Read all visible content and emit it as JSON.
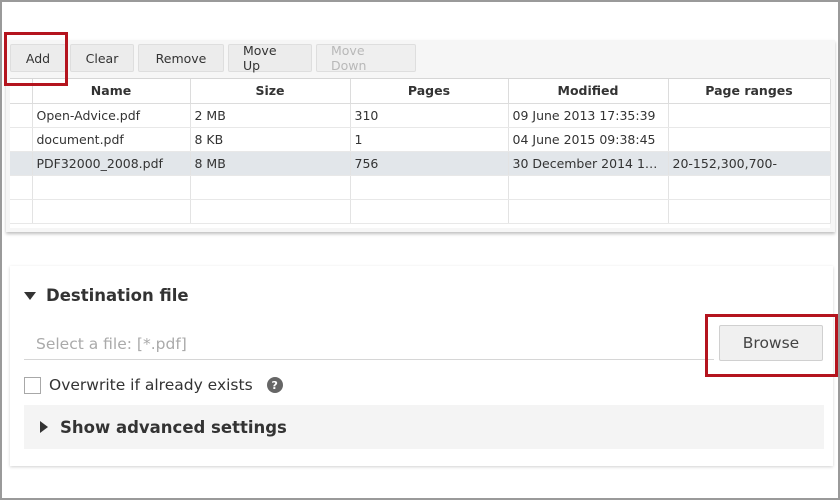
{
  "toolbar": {
    "add_label": "Add",
    "clear_label": "Clear",
    "remove_label": "Remove",
    "move_up_label": "Move Up",
    "move_down_label": "Move Down"
  },
  "table": {
    "columns": [
      "Name",
      "Size",
      "Pages",
      "Modified",
      "Page ranges"
    ],
    "rows": [
      {
        "name": "Open-Advice.pdf",
        "size": "2 MB",
        "pages": "310",
        "modified": "09 June 2013 17:35:39",
        "ranges": ""
      },
      {
        "name": "document.pdf",
        "size": "8 KB",
        "pages": "1",
        "modified": "04 June 2015 09:38:45",
        "ranges": ""
      },
      {
        "name": "PDF32000_2008.pdf",
        "size": "8 MB",
        "pages": "756",
        "modified": "30 December 2014 18:...",
        "ranges": "20-152,300,700-"
      }
    ],
    "selected_row": 2
  },
  "destination": {
    "title": "Destination file",
    "file_placeholder": "Select a file: [*.pdf]",
    "file_value": "",
    "browse_label": "Browse",
    "overwrite_label": "Overwrite if already exists",
    "overwrite_checked": false,
    "help_glyph": "?",
    "advanced_label": "Show advanced settings"
  },
  "icons": {
    "section_expanded": "triangle-down-icon",
    "advanced_collapsed": "triangle-right-icon",
    "help": "help-icon"
  },
  "colors": {
    "highlight": "#b4141e",
    "selected_row": "#e2e6ea",
    "disabled_text": "#b8b8b8"
  }
}
